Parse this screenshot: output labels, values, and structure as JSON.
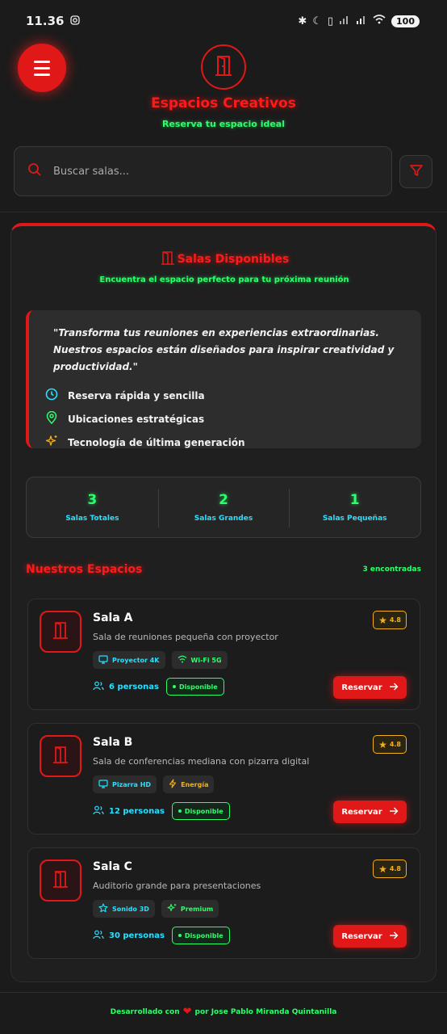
{
  "status_bar": {
    "time": "11.36",
    "battery": "100"
  },
  "header": {
    "title": "Espacios Creativos",
    "subtitle": "Reserva tu espacio ideal"
  },
  "search": {
    "placeholder": "Buscar salas..."
  },
  "section": {
    "title": "Salas Disponibles",
    "subtitle": "Encuentra el espacio perfecto para tu próxima reunión"
  },
  "quote": {
    "text": "\"Transforma tus reuniones en experiencias extraordinarias. Nuestros espacios están diseñados para inspirar creatividad y productividad.\"",
    "features": [
      {
        "icon": "clock-icon",
        "label": "Reserva rápida y sencilla"
      },
      {
        "icon": "location-pin-icon",
        "label": "Ubicaciones estratégicas"
      },
      {
        "icon": "sparkles-icon",
        "label": "Tecnología de última generación"
      }
    ]
  },
  "stats": [
    {
      "value": "3",
      "label": "Salas Totales"
    },
    {
      "value": "2",
      "label": "Salas Grandes"
    },
    {
      "value": "1",
      "label": "Salas Pequeñas"
    }
  ],
  "spaces": {
    "title": "Nuestros Espacios",
    "count": "3 encontradas",
    "rooms": [
      {
        "name": "Sala A",
        "description": "Sala de reuniones pequeña con proyector",
        "rating": "4.8",
        "tags": [
          {
            "label": "Proyector 4K",
            "icon": "monitor-icon",
            "color": "cyan"
          },
          {
            "label": "Wi-Fi 5G",
            "icon": "wifi-icon",
            "color": "green"
          }
        ],
        "capacity": "6 personas",
        "status": "Disponible",
        "action": "Reservar"
      },
      {
        "name": "Sala B",
        "description": "Sala de conferencias mediana con pizarra digital",
        "rating": "4.8",
        "tags": [
          {
            "label": "Pizarra HD",
            "icon": "monitor-icon",
            "color": "cyan"
          },
          {
            "label": "Energía",
            "icon": "lightning-icon",
            "color": "yellow"
          }
        ],
        "capacity": "12 personas",
        "status": "Disponible",
        "action": "Reservar"
      },
      {
        "name": "Sala C",
        "description": "Auditorio grande para presentaciones",
        "rating": "4.8",
        "tags": [
          {
            "label": "Sonido 3D",
            "icon": "star-outline-icon",
            "color": "cyan"
          },
          {
            "label": "Premium",
            "icon": "sparkles-icon",
            "color": "green"
          }
        ],
        "capacity": "30 personas",
        "status": "Disponible",
        "action": "Reservar"
      }
    ]
  },
  "footer": {
    "prefix": "Desarrollado con",
    "suffix": "por Jose Pablo Miranda Quintanilla"
  },
  "colors": {
    "accent_red": "#e01818",
    "neon_green": "#2cff6c",
    "cyan": "#27e0ff",
    "gold": "#f2b01e",
    "background": "#1b1b1b"
  }
}
